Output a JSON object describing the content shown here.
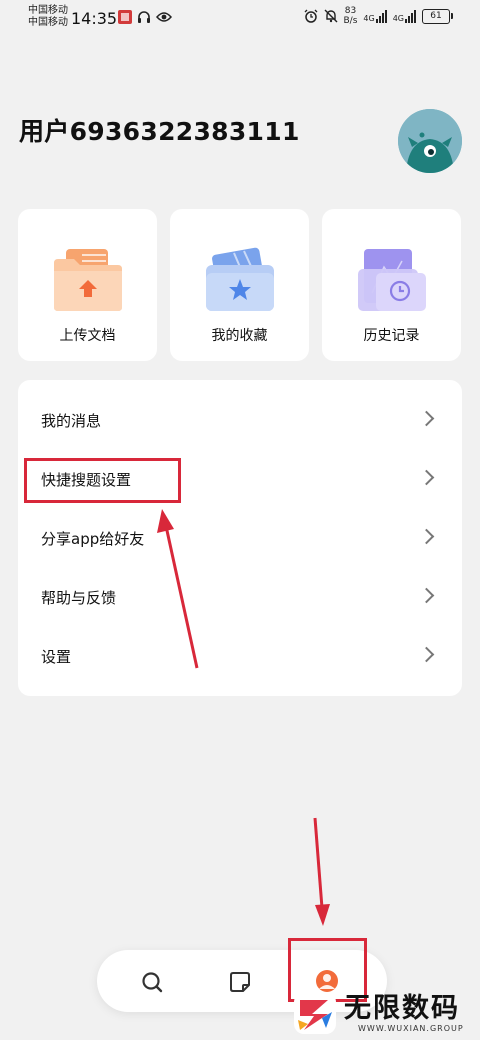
{
  "status_bar": {
    "carrier_1": "中国移动",
    "carrier_2": "中国移动",
    "time": "14:35",
    "net_speed_value": "83",
    "net_speed_unit": "B/s",
    "signal_1": "4G",
    "signal_2": "4G",
    "battery": "61"
  },
  "profile": {
    "username": "用户6936322383111"
  },
  "quick_actions": [
    {
      "label": "上传文档",
      "icon": "upload-folder-icon"
    },
    {
      "label": "我的收藏",
      "icon": "favorites-star-icon"
    },
    {
      "label": "历史记录",
      "icon": "history-clock-icon"
    }
  ],
  "menu": {
    "items": [
      {
        "label": "我的消息"
      },
      {
        "label": "快捷搜题设置"
      },
      {
        "label": "分享app给好友"
      },
      {
        "label": "帮助与反馈"
      },
      {
        "label": "设置"
      }
    ]
  },
  "bottom_nav": {
    "items": [
      {
        "icon": "search-icon"
      },
      {
        "icon": "notes-icon"
      },
      {
        "icon": "profile-icon",
        "active": true
      }
    ]
  },
  "watermark": {
    "title": "无限数码",
    "subtitle": "WWW.WUXIAN.GROUP"
  },
  "colors": {
    "annotation_red": "#d8283a",
    "accent_orange": "#f26b3a",
    "background": "#f1f1f1"
  }
}
